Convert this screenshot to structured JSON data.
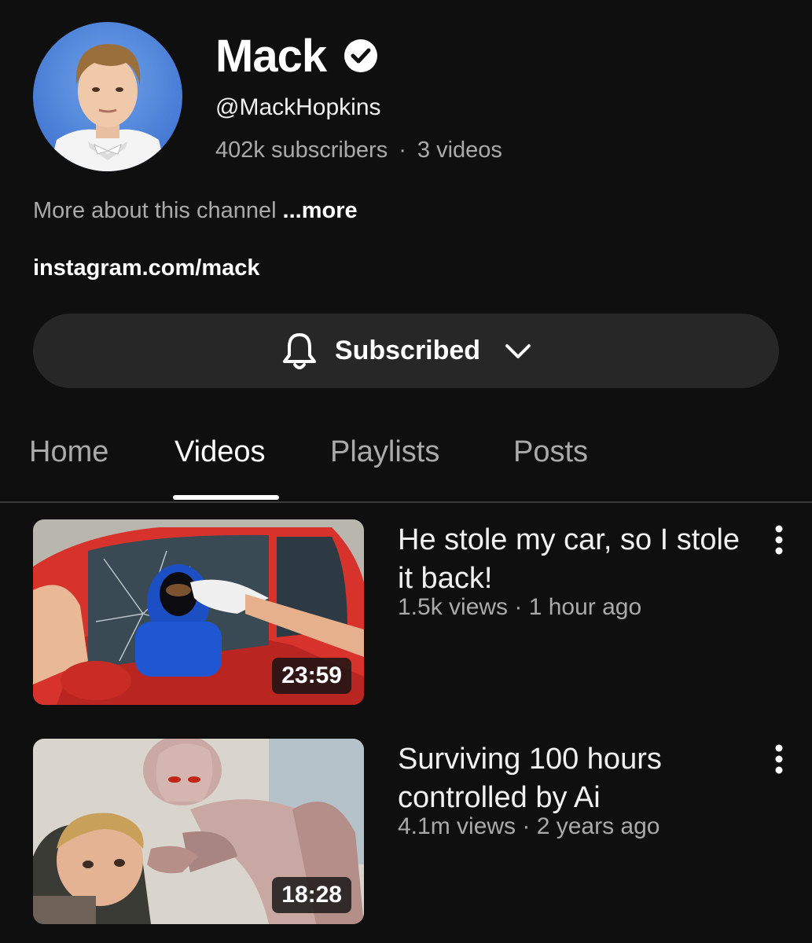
{
  "channel": {
    "name": "Mack",
    "handle": "@MackHopkins",
    "subscribers": "402k subscribers",
    "separator": "·",
    "videos_count": "3 videos",
    "about_text": "More about this channel",
    "about_more": "...more",
    "link": "instagram.com/mack",
    "verified_icon": "verified-check-icon"
  },
  "subscribe": {
    "label": "Subscribed",
    "icon": "bell-icon",
    "dropdown_icon": "chevron-down-icon"
  },
  "tabs": [
    {
      "label": "Home",
      "active": false
    },
    {
      "label": "Videos",
      "active": true
    },
    {
      "label": "Playlists",
      "active": false
    },
    {
      "label": "Posts",
      "active": false
    }
  ],
  "videos": [
    {
      "title": "He stole my car, so I stole it back!",
      "views": "1.5k views",
      "age": "1 hour ago",
      "meta": "1.5k views · 1 hour ago",
      "duration": "23:59"
    },
    {
      "title": "Surviving 100 hours controlled by Ai",
      "views": "4.1m views",
      "age": "2 years ago",
      "meta": "4.1m views · 2 years ago",
      "duration": "18:28"
    }
  ],
  "colors": {
    "background": "#0f0f0f",
    "button_bg": "#272727",
    "secondary_text": "#aaaaaa",
    "primary_text": "#f1f1f1"
  }
}
